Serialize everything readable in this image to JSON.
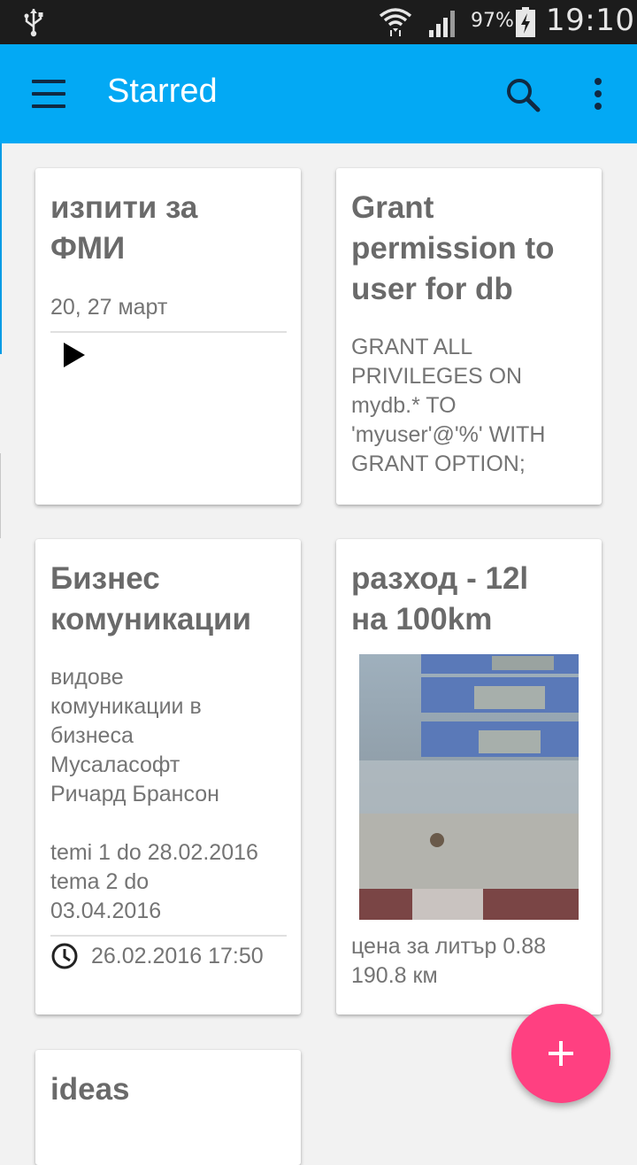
{
  "status_bar": {
    "battery_percent": "97%",
    "time": "19:10",
    "icons": [
      "usb-icon",
      "wifi-icon",
      "signal-icon",
      "battery-charging-icon"
    ]
  },
  "app_bar": {
    "title": "Starred",
    "color": "#03a9f4",
    "icons": [
      "menu-icon",
      "search-icon",
      "more-vert-icon"
    ]
  },
  "notes": [
    {
      "title_lines": [
        "изпити за",
        "ФМИ"
      ],
      "body": "20, 27 март",
      "icon": "play-icon"
    },
    {
      "title_lines": [
        "Grant",
        "permission to",
        "user for db"
      ],
      "body_lines": [
        "GRANT ALL",
        "PRIVILEGES ON",
        "mydb.* TO",
        "'myuser'@'%' WITH",
        "GRANT OPTION;"
      ]
    },
    {
      "title_lines": [
        "Бизнес",
        "комуникации"
      ],
      "body_lines": [
        "видове",
        "комуникации в",
        "бизнеса",
        "Мусаласофт",
        "Ричард Брансон",
        "",
        "temi 1 do 28.02.2016",
        "tema 2 do",
        "03.04.2016"
      ],
      "reminder": "26.02.2016 17:50",
      "reminder_icon": "clock-icon"
    },
    {
      "title_lines": [
        "разход - 12l",
        "на 100km"
      ],
      "image": "fuel-pump-photo",
      "body_lines": [
        "цена за литър 0.88",
        "190.8 км"
      ]
    },
    {
      "title_lines": [
        "ideas"
      ]
    }
  ],
  "fab": {
    "icon": "plus-icon",
    "color": "#ff4081"
  }
}
